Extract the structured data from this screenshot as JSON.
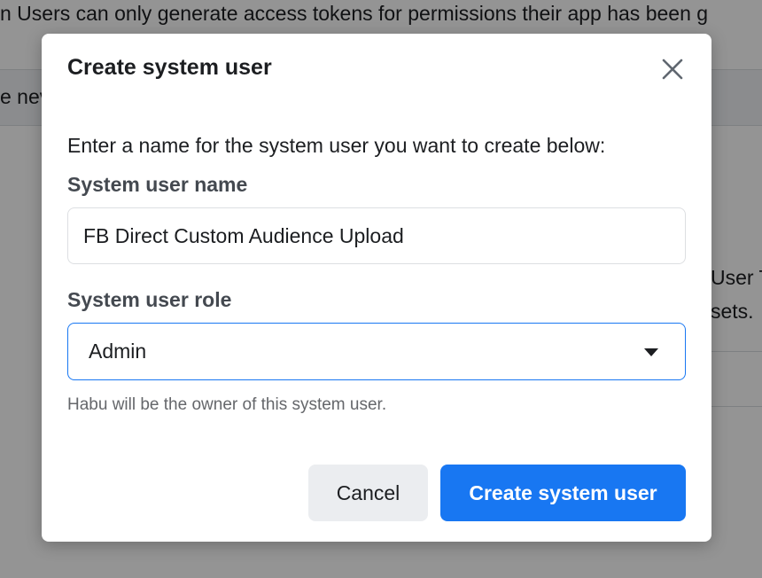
{
  "background": {
    "top_text": "n Users can only generate access tokens for permissions their app has been g",
    "bar_text": "e nev",
    "right_text_1": "User T",
    "right_text_2": "sets."
  },
  "modal": {
    "title": "Create system user",
    "close_icon": "close-icon",
    "intro": "Enter a name for the system user you want to create below:",
    "name_field": {
      "label": "System user name",
      "value": "FB Direct Custom Audience Upload"
    },
    "role_field": {
      "label": "System user role",
      "selected": "Admin"
    },
    "helper_text": "Habu will be the owner of this system user.",
    "buttons": {
      "cancel": "Cancel",
      "create": "Create system user"
    }
  },
  "colors": {
    "primary": "#1877f2",
    "secondary_button": "#ebedf0",
    "text": "#1c1e21",
    "muted": "#65676b"
  }
}
